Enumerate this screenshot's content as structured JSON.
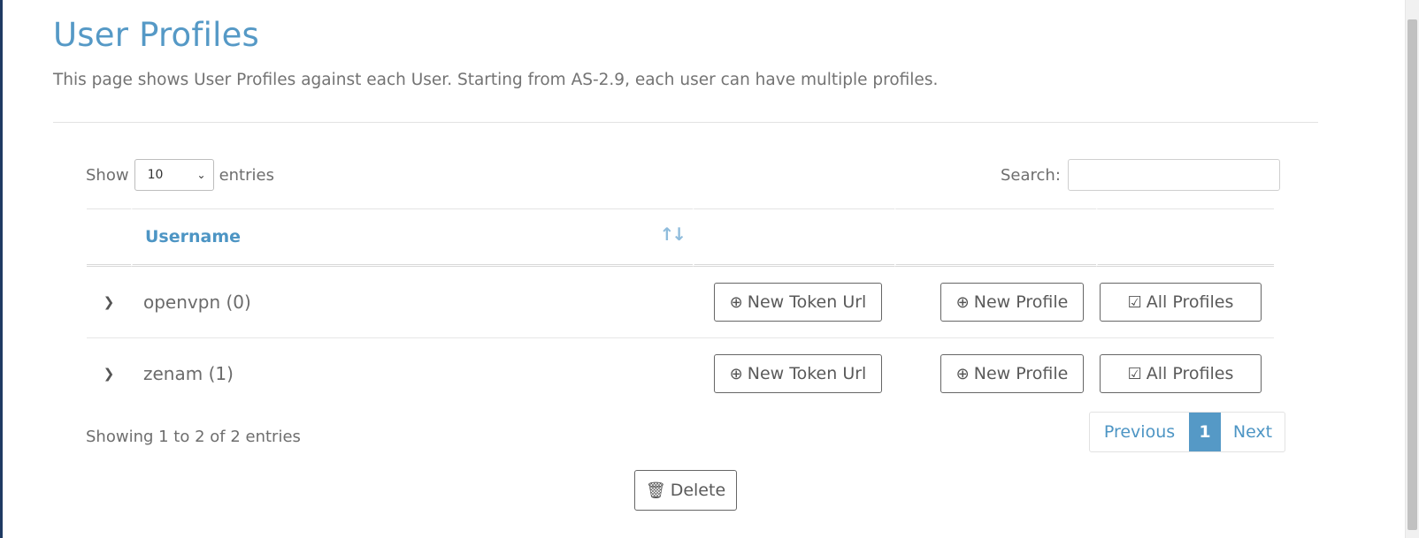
{
  "page": {
    "title": "User Profiles",
    "subtitle": "This page shows User Profiles against each User. Starting from AS-2.9, each user can have multiple profiles."
  },
  "controls": {
    "show_label": "Show",
    "length_value": "10",
    "entries_label": "entries",
    "search_label": "Search:",
    "search_value": ""
  },
  "table": {
    "username_header": "Username",
    "rows": [
      {
        "username": "openvpn (0)",
        "token_btn": "New Token Url",
        "profile_btn": "New Profile",
        "all_btn": "All Profiles"
      },
      {
        "username": "zenam (1)",
        "token_btn": "New Token Url",
        "profile_btn": "New Profile",
        "all_btn": "All Profiles"
      }
    ]
  },
  "footer": {
    "info": "Showing 1 to 2 of 2 entries",
    "prev": "Previous",
    "current_page": "1",
    "next": "Next",
    "delete_label": "Delete"
  },
  "colors": {
    "accent": "#5599c6",
    "left_border": "#1f3a63"
  },
  "icons": [
    "plus-circle-icon",
    "check-square-icon",
    "trash-icon",
    "chevron-down-icon",
    "sort-icon"
  ]
}
